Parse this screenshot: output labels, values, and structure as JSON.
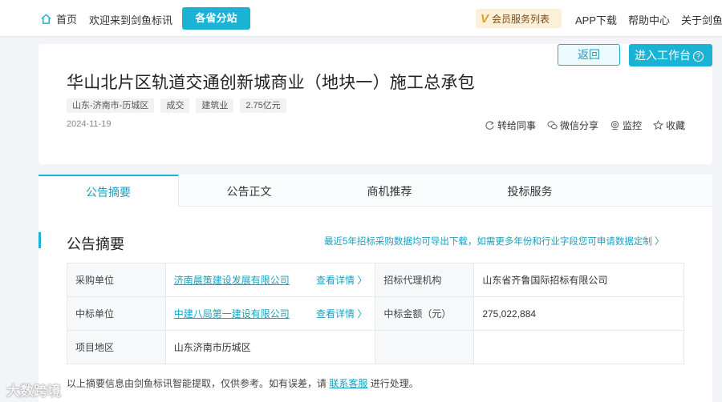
{
  "nav": {
    "home": "首页",
    "welcome": "欢迎来到剑鱼标讯",
    "branch": "各省分站",
    "vip": "会员服务列表",
    "app": "APP下载",
    "help": "帮助中心",
    "about": "关于剑鱼"
  },
  "header": {
    "back": "返回",
    "workbench": "进入工作台",
    "title": "华山北片区轨道交通创新城商业（地块一）施工总承包",
    "tags": [
      "山东-济南市-历城区",
      "成交",
      "建筑业",
      "2.75亿元"
    ],
    "date": "2024-11-19",
    "actions": [
      "转给同事",
      "微信分享",
      "监控",
      "收藏"
    ]
  },
  "tabs": [
    "公告摘要",
    "公告正文",
    "商机推荐",
    "投标服务"
  ],
  "summary": {
    "title": "公告摘要",
    "note": "最近5年招标采购数据均可导出下载，如需更多年份和行业字段您可申请数据定制 〉",
    "rows": [
      {
        "label": "采购单位",
        "value": "济南晨策建设发展有限公司",
        "more": "查看详情 〉",
        "label2": "招标代理机构",
        "value2": "山东省齐鲁国际招标有限公司"
      },
      {
        "label": "中标单位",
        "value": "中建八局第一建设有限公司",
        "more": "查看详情 〉",
        "label2": "中标金额（元）",
        "value2": "275,022,884"
      },
      {
        "label": "项目地区",
        "value": "山东济南市历城区",
        "more": "",
        "label2": "",
        "value2": ""
      }
    ],
    "footer_pre": "以上摘要信息由剑鱼标讯智能提取，仅供参考。如有误差，请",
    "footer_link": "联系客服",
    "footer_post": "进行处理。"
  },
  "watermark": "大数跨境",
  "colors": {
    "accent": "#1ab3d4",
    "link": "#1a9fbf"
  }
}
